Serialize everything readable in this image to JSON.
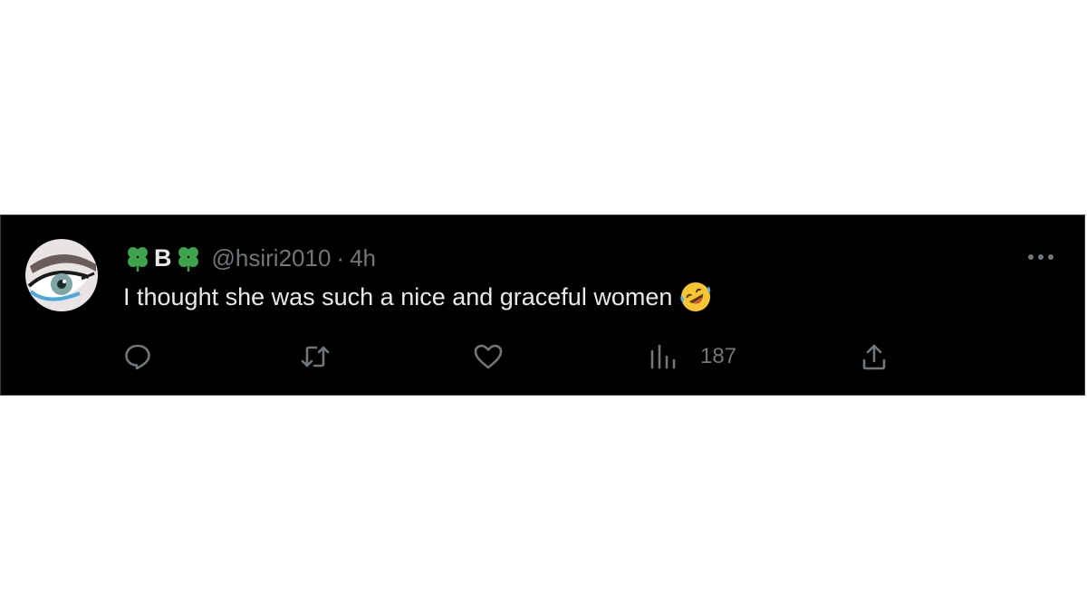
{
  "tweet": {
    "display_name_letter": "B",
    "handle": "@hsiri2010",
    "separator": "·",
    "time": "4h",
    "text": "I thought she was such a nice and graceful women",
    "text_emoji": "rolling-on-floor-laughing-emoji",
    "name_decoration_icon": "four-leaf-clover-icon"
  },
  "actions": {
    "reply_icon": "reply-icon",
    "retweet_icon": "retweet-icon",
    "like_icon": "heart-icon",
    "views_icon": "views-icon",
    "views_count": "187",
    "share_icon": "share-icon"
  },
  "colors": {
    "background": "#000000",
    "primary_text": "#e7e9ea",
    "secondary_text": "#71767b",
    "clover_green": "#3fa34d",
    "page_background": "#ffffff"
  }
}
